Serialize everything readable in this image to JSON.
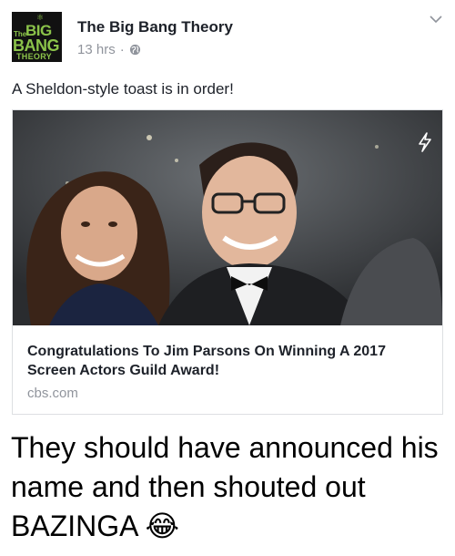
{
  "post": {
    "page_logo": {
      "the": "The",
      "big": "BIG",
      "bang": "BANG",
      "theory": "THEORY"
    },
    "page_name": "The Big Bang Theory",
    "time_ago": "13 hrs",
    "separator": "·",
    "privacy_icon": "globe-icon",
    "menu_icon": "chevron-down-icon",
    "text": "A Sheldon-style toast is in order!",
    "link_card": {
      "photo_icon": "lightning-bolt-icon",
      "title": "Congratulations To Jim Parsons On Winning A 2017 Screen Actors Guild Award!",
      "domain": "cbs.com"
    }
  },
  "caption": {
    "text": "They should have announced his name and then shouted out BAZINGA",
    "emoji": "😂"
  },
  "colors": {
    "logo_green": "#8bc34a",
    "meta_gray": "#90949c",
    "text_dark": "#1d2129",
    "card_border": "#dddfe2"
  }
}
